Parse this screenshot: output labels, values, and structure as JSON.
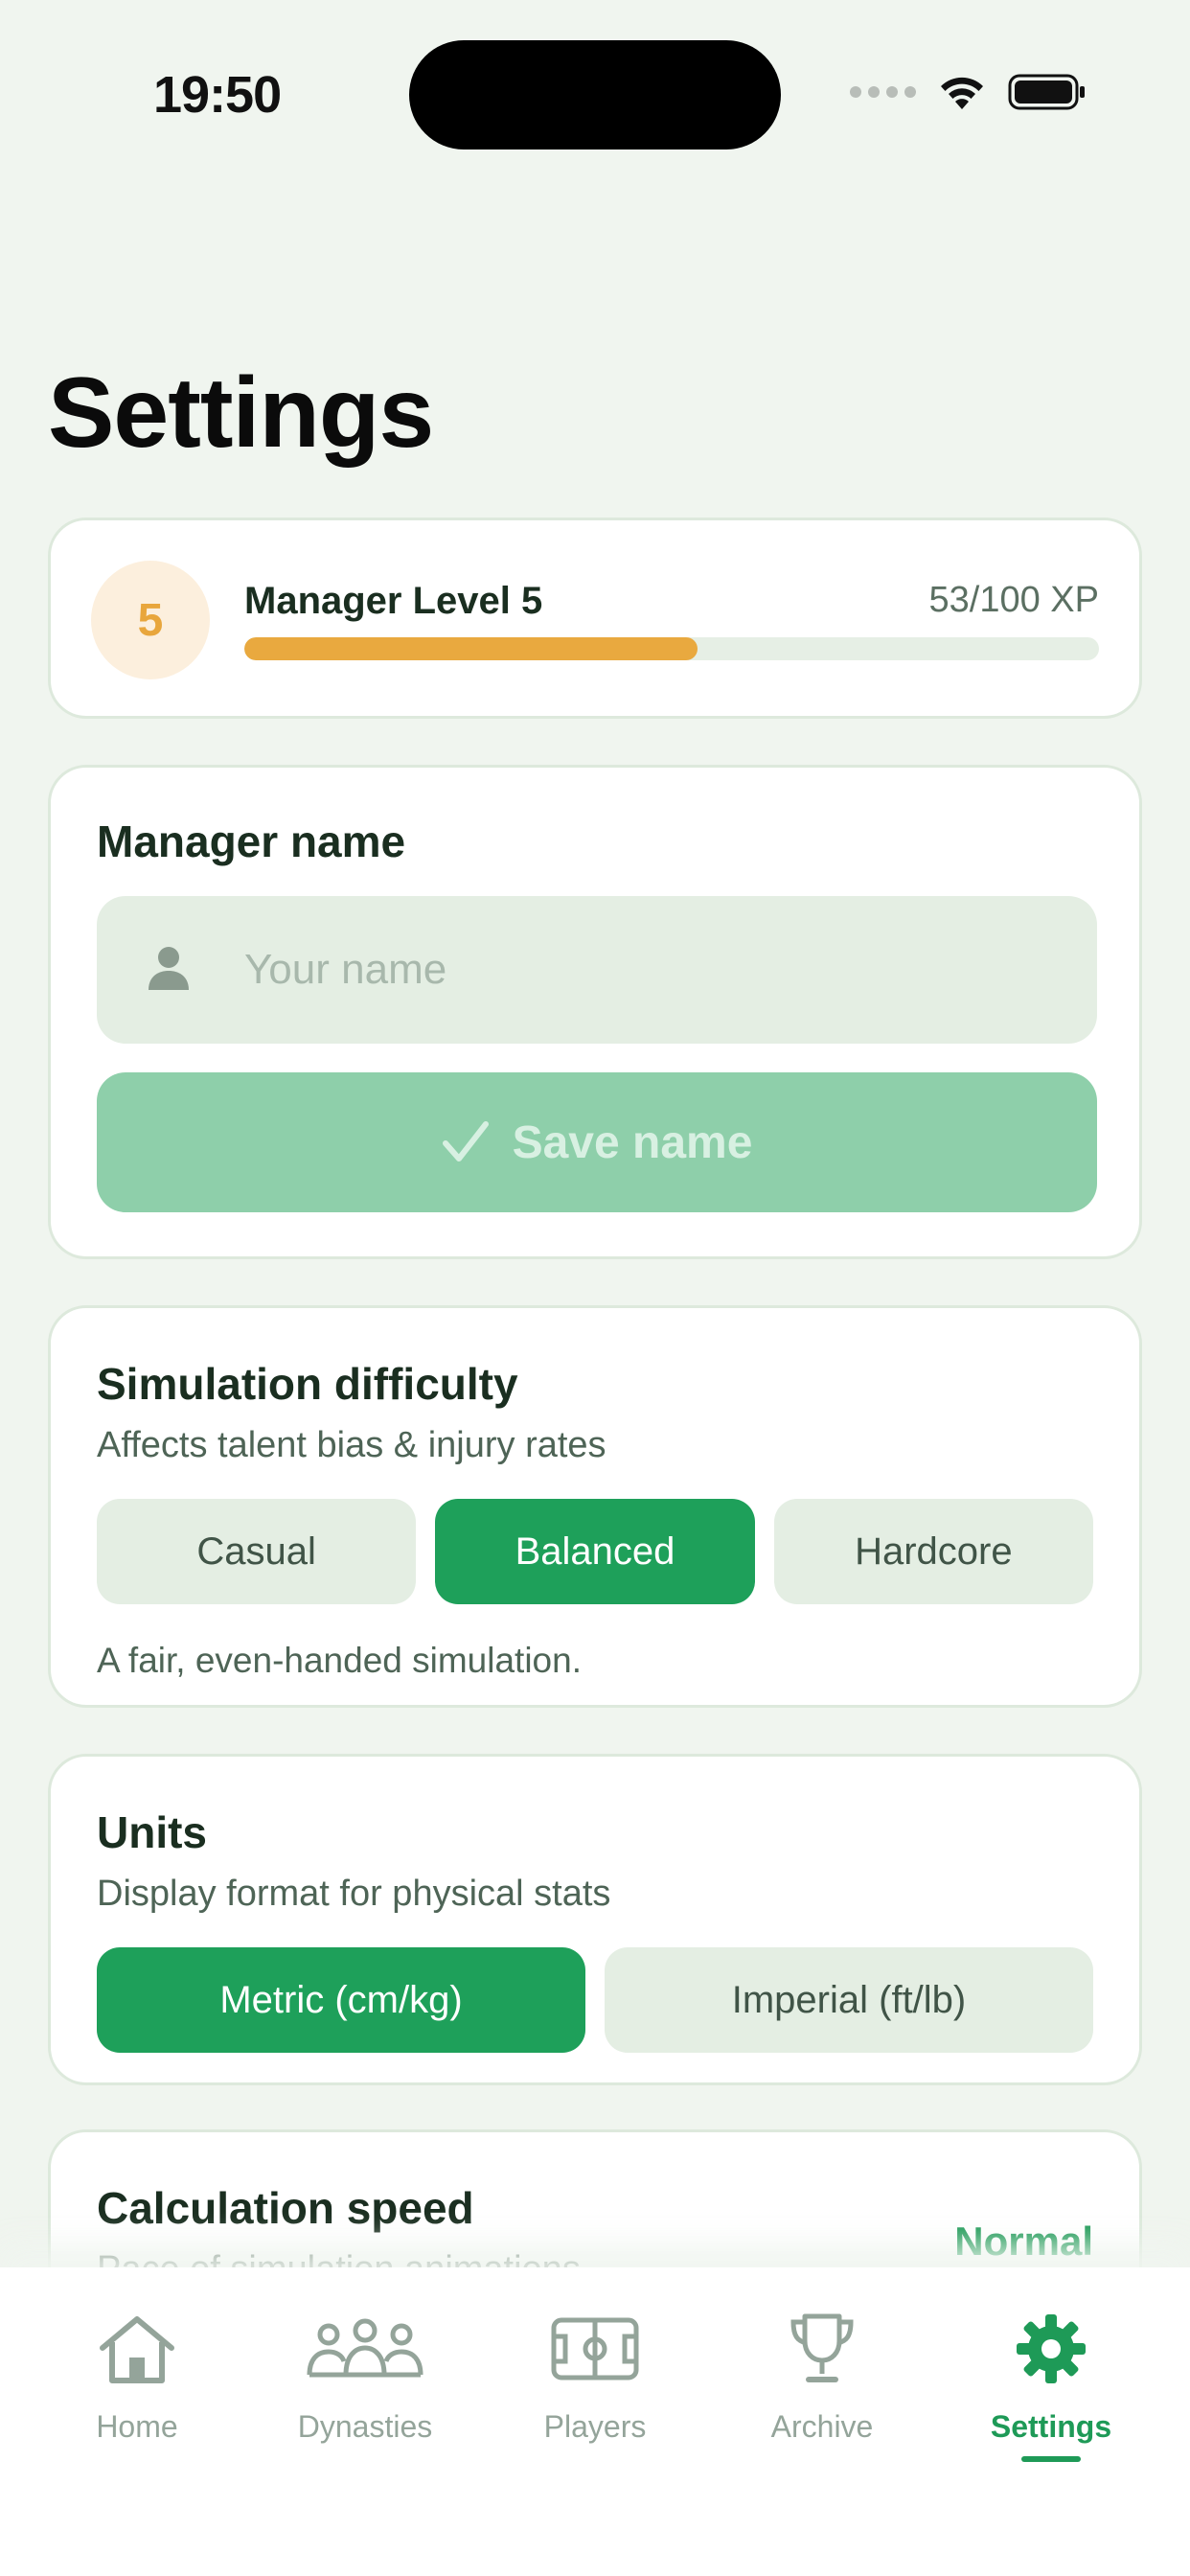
{
  "status_bar": {
    "time": "19:50"
  },
  "page": {
    "title": "Settings"
  },
  "level": {
    "badge": "5",
    "title": "Manager Level 5",
    "xp_text": "53/100 XP",
    "progress": 0.53,
    "accent_color": "#e9a93f"
  },
  "manager_name": {
    "title": "Manager name",
    "placeholder": "Your name",
    "value": "",
    "save_label": "Save name",
    "icon": "person-icon"
  },
  "difficulty": {
    "title": "Simulation difficulty",
    "subtitle": "Affects talent bias & injury rates",
    "options": [
      "Casual",
      "Balanced",
      "Hardcore"
    ],
    "selected": "Balanced",
    "description": "A fair, even-handed simulation."
  },
  "units": {
    "title": "Units",
    "subtitle": "Display format for physical stats",
    "options": [
      "Metric (cm/kg)",
      "Imperial (ft/lb)"
    ],
    "selected": "Metric (cm/kg)"
  },
  "speed": {
    "title": "Calculation speed",
    "subtitle": "Pace of simulation animations",
    "value": "Normal"
  },
  "tabs": [
    {
      "label": "Home",
      "icon": "home-icon"
    },
    {
      "label": "Dynasties",
      "icon": "people-group-icon"
    },
    {
      "label": "Players",
      "icon": "pitch-icon"
    },
    {
      "label": "Archive",
      "icon": "trophy-icon"
    },
    {
      "label": "Settings",
      "icon": "gear-icon",
      "active": true
    }
  ],
  "colors": {
    "primary": "#1ea05a",
    "primary_disabled": "#8ecfaa",
    "background": "#f0f5ef"
  }
}
